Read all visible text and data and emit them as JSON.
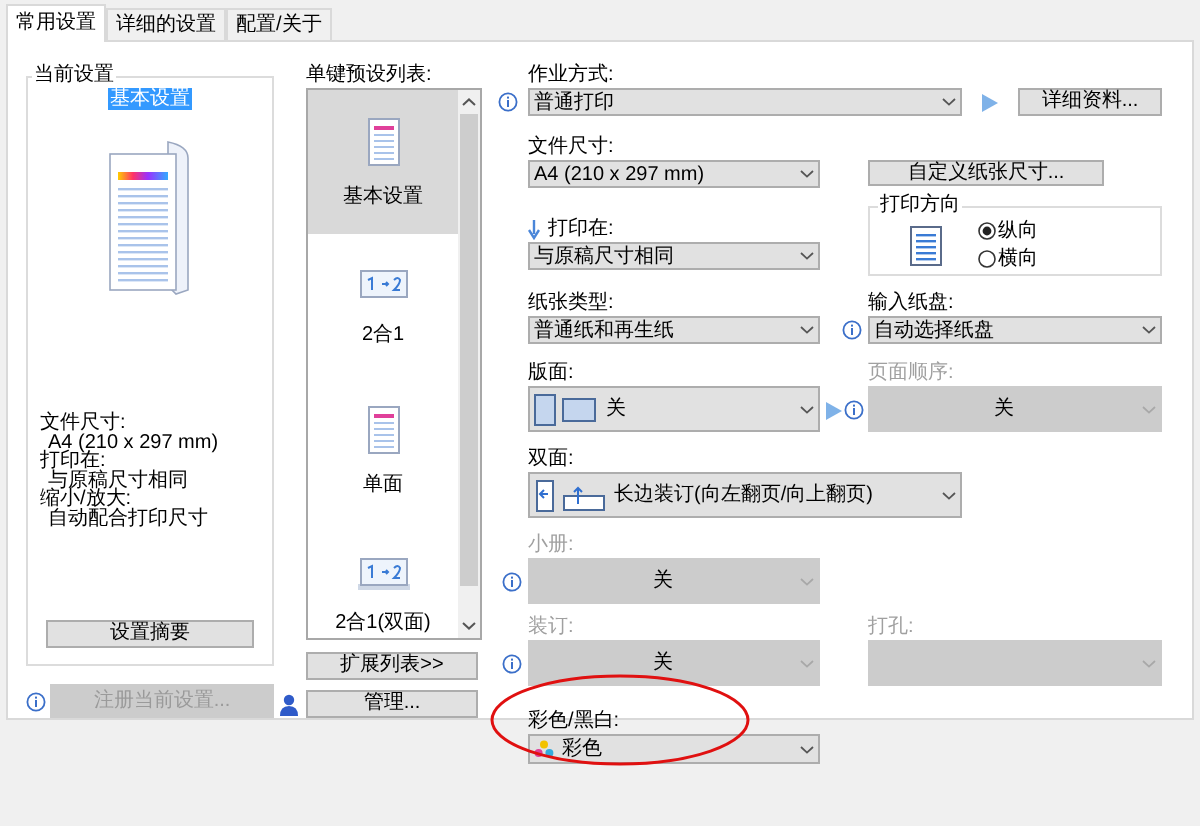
{
  "tabs": [
    {
      "label": "常用设置",
      "selected": true
    },
    {
      "label": "详细的设置",
      "selected": false
    },
    {
      "label": "配置/关于",
      "selected": false
    }
  ],
  "current_settings": {
    "title": "当前设置",
    "preset_name": "基本设置",
    "summary": [
      {
        "label": "文件尺寸:",
        "value": "A4 (210 x 297 mm)"
      },
      {
        "label": "打印在:",
        "value": "与原稿尺寸相同"
      },
      {
        "label": "缩小/放大:",
        "value": "自动配合打印尺寸"
      }
    ],
    "summary_button": "设置摘要"
  },
  "register_button": {
    "label": "注册当前设置...",
    "disabled": true
  },
  "presets": {
    "label": "单键预设列表:",
    "items": [
      {
        "label": "基本设置",
        "kind": "basic",
        "selected": true
      },
      {
        "label": "2合1",
        "kind": "two_in_one",
        "selected": false
      },
      {
        "label": "单面",
        "kind": "single",
        "selected": false
      },
      {
        "label": "2合1(双面)",
        "kind": "two_in_one_duplex",
        "selected": false
      }
    ]
  },
  "expand_button": "扩展列表>>",
  "manage_button": "管理...",
  "job_mode": {
    "label": "作业方式:",
    "value": "普通打印"
  },
  "details_button": "详细资料...",
  "document_size": {
    "label": "文件尺寸:",
    "value": "A4 (210 x 297 mm)"
  },
  "custom_size_button": "自定义纸张尺寸...",
  "print_on": {
    "label": "打印在:",
    "value": "与原稿尺寸相同"
  },
  "orientation": {
    "title": "打印方向",
    "options": [
      {
        "label": "纵向",
        "selected": true
      },
      {
        "label": "横向",
        "selected": false
      }
    ]
  },
  "paper_type": {
    "label": "纸张类型:",
    "value": "普通纸和再生纸"
  },
  "input_tray": {
    "label": "输入纸盘:",
    "value": "自动选择纸盘"
  },
  "layout": {
    "label": "版面:",
    "value": "关"
  },
  "page_order": {
    "label": "页面顺序:",
    "value": "关",
    "disabled": true
  },
  "duplex": {
    "label": "双面:",
    "value": "长边装订(向左翻页/向上翻页)"
  },
  "booklet": {
    "label": "小册:",
    "value": "关",
    "disabled": true
  },
  "binding": {
    "label": "装订:",
    "value": "关",
    "disabled": true
  },
  "punch": {
    "label": "打孔:",
    "disabled": true
  },
  "color_mode": {
    "label": "彩色/黑白:",
    "value": "彩色"
  }
}
